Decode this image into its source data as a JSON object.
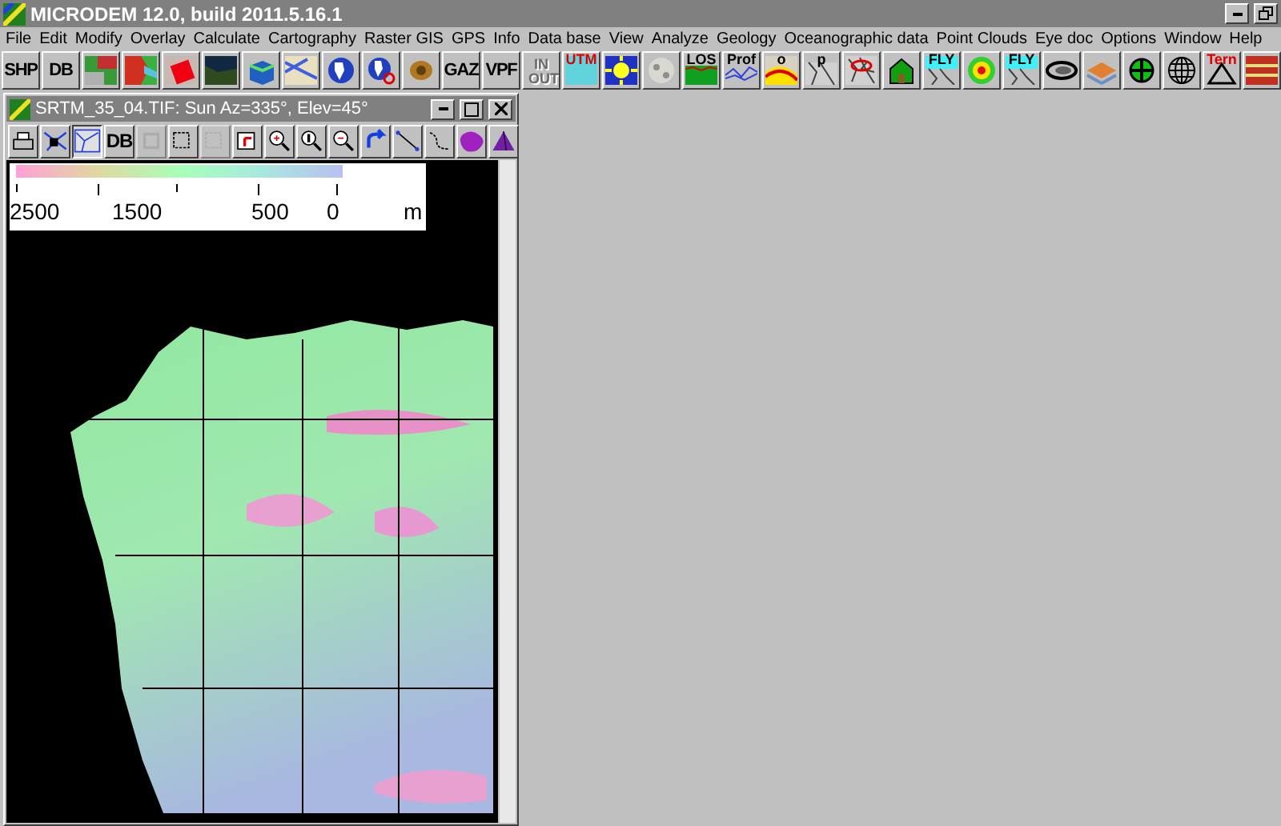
{
  "window": {
    "title": "MICRODEM 12.0, build 2011.5.16.1"
  },
  "menu": [
    "File",
    "Edit",
    "Modify",
    "Overlay",
    "Calculate",
    "Cartography",
    "Raster GIS",
    "GPS",
    "Info",
    "Data base",
    "View",
    "Analyze",
    "Geology",
    "Oceanographic data",
    "Point Clouds",
    "Eye doc",
    "Options",
    "Window",
    "Help"
  ],
  "toolbar": [
    {
      "kind": "text",
      "label": "SHP",
      "disabled": false
    },
    {
      "kind": "text",
      "label": "DB",
      "disabled": false
    },
    {
      "kind": "icon",
      "disabled": false
    },
    {
      "kind": "icon",
      "disabled": false
    },
    {
      "kind": "icon",
      "disabled": false
    },
    {
      "kind": "icon",
      "disabled": false
    },
    {
      "kind": "icon",
      "disabled": false
    },
    {
      "kind": "icon",
      "disabled": false
    },
    {
      "kind": "icon",
      "disabled": false
    },
    {
      "kind": "icon",
      "disabled": false
    },
    {
      "kind": "icon",
      "disabled": false
    },
    {
      "kind": "text",
      "label": "GAZ",
      "disabled": false
    },
    {
      "kind": "text",
      "label": "VPF",
      "disabled": false
    },
    {
      "kind": "caption",
      "label": "IN OUT",
      "disabled": true
    },
    {
      "kind": "caption",
      "label": "UTM",
      "disabled": false
    },
    {
      "kind": "icon",
      "disabled": false
    },
    {
      "kind": "icon",
      "disabled": false
    },
    {
      "kind": "caption",
      "label": "LOS",
      "disabled": false
    },
    {
      "kind": "caption",
      "label": "Prof",
      "disabled": false
    },
    {
      "kind": "caption",
      "label": "o",
      "disabled": false
    },
    {
      "kind": "caption",
      "label": "p",
      "disabled": false
    },
    {
      "kind": "icon",
      "disabled": false
    },
    {
      "kind": "icon",
      "disabled": false
    },
    {
      "kind": "caption",
      "label": "FLY",
      "disabled": false
    },
    {
      "kind": "icon",
      "disabled": false
    },
    {
      "kind": "caption",
      "label": "FLY",
      "disabled": false
    },
    {
      "kind": "icon",
      "disabled": false
    },
    {
      "kind": "icon",
      "disabled": false
    },
    {
      "kind": "icon",
      "disabled": false
    },
    {
      "kind": "icon",
      "disabled": false
    },
    {
      "kind": "caption",
      "label": "Tern",
      "disabled": false
    },
    {
      "kind": "icon",
      "disabled": false
    }
  ],
  "map_window": {
    "title": "SRTM_35_04.TIF: Sun Az=335°, Elev=45°",
    "toolbar": [
      {
        "kind": "icon",
        "selected": false,
        "disabled": false
      },
      {
        "kind": "icon",
        "selected": false,
        "disabled": false
      },
      {
        "kind": "icon",
        "selected": true,
        "disabled": false
      },
      {
        "kind": "text",
        "label": "DB",
        "selected": false,
        "disabled": false
      },
      {
        "kind": "icon",
        "selected": false,
        "disabled": true
      },
      {
        "kind": "icon",
        "selected": false,
        "disabled": false
      },
      {
        "kind": "icon",
        "selected": false,
        "disabled": true
      },
      {
        "kind": "icon",
        "selected": false,
        "disabled": false
      },
      {
        "kind": "icon",
        "selected": false,
        "disabled": false
      },
      {
        "kind": "icon",
        "selected": false,
        "disabled": false
      },
      {
        "kind": "icon",
        "selected": false,
        "disabled": false
      },
      {
        "kind": "icon",
        "selected": false,
        "disabled": false
      },
      {
        "kind": "icon",
        "selected": false,
        "disabled": false
      },
      {
        "kind": "icon",
        "selected": false,
        "disabled": false
      },
      {
        "kind": "icon",
        "selected": false,
        "disabled": false
      },
      {
        "kind": "icon",
        "selected": false,
        "disabled": false
      }
    ],
    "legend": {
      "labels": [
        "2500",
        "1500",
        "500",
        "0"
      ],
      "unit": "m"
    }
  }
}
